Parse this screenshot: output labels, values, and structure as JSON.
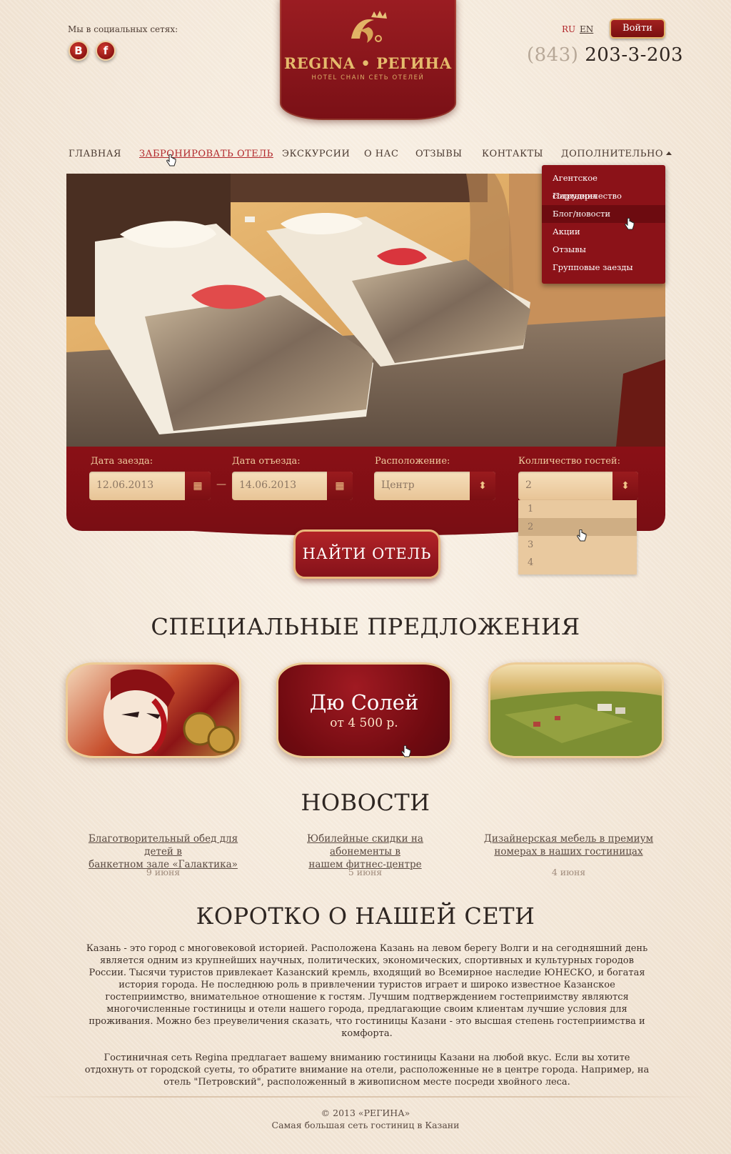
{
  "header": {
    "social_label": "Мы в социальных сетях:",
    "social": [
      {
        "icon": "vk-icon",
        "glyph": "B"
      },
      {
        "icon": "facebook-icon",
        "glyph": "f"
      }
    ],
    "logo": {
      "name": "REGINA • РЕГИНА",
      "subtitle": "HOTEL CHAIN   СЕТЬ ОТЕЛЕЙ"
    },
    "lang": {
      "ru": "RU",
      "en": "EN"
    },
    "login_label": "Войти",
    "phone_code": "(843)",
    "phone_number": "203-3-203"
  },
  "nav": {
    "items": [
      {
        "label": "ГЛАВНАЯ"
      },
      {
        "label": "ЗАБРОНИРОВАТЬ ОТЕЛЬ"
      },
      {
        "label": "ЭКСКУРСИИ"
      },
      {
        "label": "О НАС"
      },
      {
        "label": "ОТЗЫВЫ"
      },
      {
        "label": "КОНТАКТЫ"
      },
      {
        "label": "ДОПОЛНИТЕЛЬНО"
      }
    ],
    "active_index": 1,
    "dropdown": [
      "Агентское сотрудничество",
      "Партнеры",
      "Блог/новости",
      "Акции",
      "Отзывы",
      "Групповые заезды"
    ],
    "dropdown_highlight_index": 2
  },
  "search": {
    "checkin_label": "Дата заезда:",
    "checkin_value": "12.06.2013",
    "checkout_label": "Дата отъезда:",
    "checkout_value": "14.06.2013",
    "separator": "—",
    "location_label": "Расположение:",
    "location_value": "Центр",
    "guests_label": "Колличество гостей:",
    "guests_value": "2",
    "guests_options": [
      "1",
      "2",
      "3",
      "4"
    ],
    "guests_highlight_index": 1,
    "find_button": "НАЙТИ ОТЕЛЬ"
  },
  "offers": {
    "title": "СПЕЦИАЛЬНЫЕ ПРЕДЛОЖЕНИЯ",
    "featured_title": "Дю Солей",
    "featured_price": "от 4 500 р."
  },
  "news": {
    "title": "НОВОСТИ",
    "items": [
      {
        "line1": "Благотворительный обед для детей в",
        "line2": "банкетном зале «Галактика»",
        "date": "9 июня"
      },
      {
        "line1": "Юбилейные скидки на абонементы в",
        "line2": "нашем фитнес-центре",
        "date": "5 июня"
      },
      {
        "line1": "Дизайнерская мебель в премиум",
        "line2": "номерах в наших гостиницах",
        "date": "4 июня"
      }
    ]
  },
  "about": {
    "title": "КОРОТКО О НАШЕЙ СЕТИ",
    "p1": "Казань - это город с многовековой историей. Расположена Казань на левом берегу Волги и на сегодняшний день является одним из крупнейших научных, политических, экономических, спортивных и культурных городов России. Тысячи туристов привлекает Казанский кремль, входящий во Всемирное наследие ЮНЕСКО, и богатая история города. Не последнюю роль в привлечении туристов играет и широко известное Казанское гостеприимство, внимательное отношение к гостям. Лучшим подтверждением гостеприимству являются многочисленные гостиницы и отели нашего города, предлагающие своим клиентам лучшие условия для проживания. Можно без преувеличения сказать, что гостиницы Казани - это высшая степень гостеприимства и комфорта.",
    "p2": "Гостиничная сеть Regina предлагает вашему вниманию гостиницы Казани на любой вкус. Если вы хотите отдохнуть от городской суеты, то обратите внимание на отели, расположенные не в центре города. Например, на отель \"Петровский\", расположенный в живописном месте посреди хвойного леса."
  },
  "footer": {
    "copyright": "© 2013 «РЕГИНА»",
    "tagline": "Самая большая сеть гостиниц в Казани"
  },
  "colors": {
    "brand_red": "#8b1218",
    "gold": "#e5bb6c",
    "background": "#f4e9dc"
  }
}
